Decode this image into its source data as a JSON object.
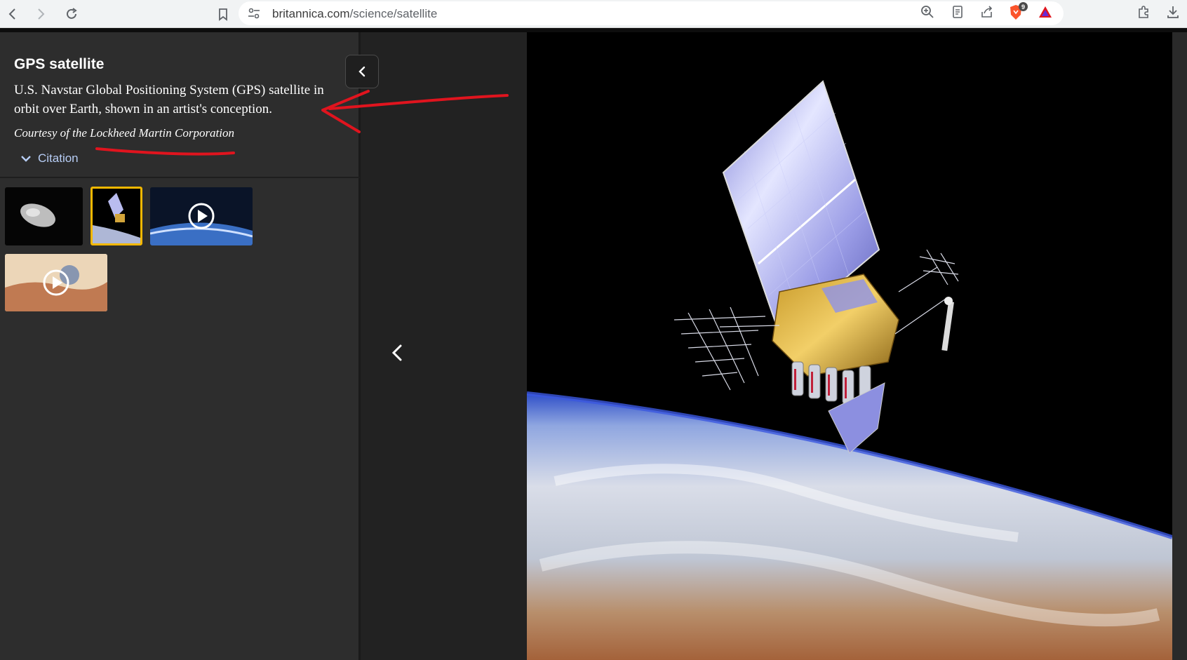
{
  "browser": {
    "url_domain": "britannica.com",
    "url_path": "/science/satellite",
    "brave_badge_count": "9"
  },
  "panel": {
    "title": "GPS satellite",
    "caption": "U.S. Navstar Global Positioning System (GPS) satellite in orbit over Earth, shown in an artist's conception.",
    "credit": "Courtesy of the Lockheed Martin Corporation",
    "citation_label": "Citation"
  },
  "thumbnails": [
    {
      "name": "asteroid",
      "type": "image",
      "active": false
    },
    {
      "name": "gps-satellite",
      "type": "image",
      "active": true
    },
    {
      "name": "earth-orbit-video",
      "type": "video",
      "active": false
    },
    {
      "name": "mars-landscape-video",
      "type": "video",
      "active": false
    }
  ],
  "icons": {
    "back": "back-icon",
    "forward": "forward-icon",
    "reload": "reload-icon",
    "bookmark": "bookmark-icon",
    "tune": "tune-icon",
    "zoom": "zoom-icon",
    "reader": "reader-icon",
    "share": "share-icon",
    "brave": "brave-shield-icon",
    "rewards": "rewards-icon",
    "extensions": "extensions-icon",
    "download": "download-icon"
  },
  "colors": {
    "accent_citation": "#b7cdf5",
    "active_thumbnail": "#f5b800",
    "annotation": "#e0141e"
  }
}
